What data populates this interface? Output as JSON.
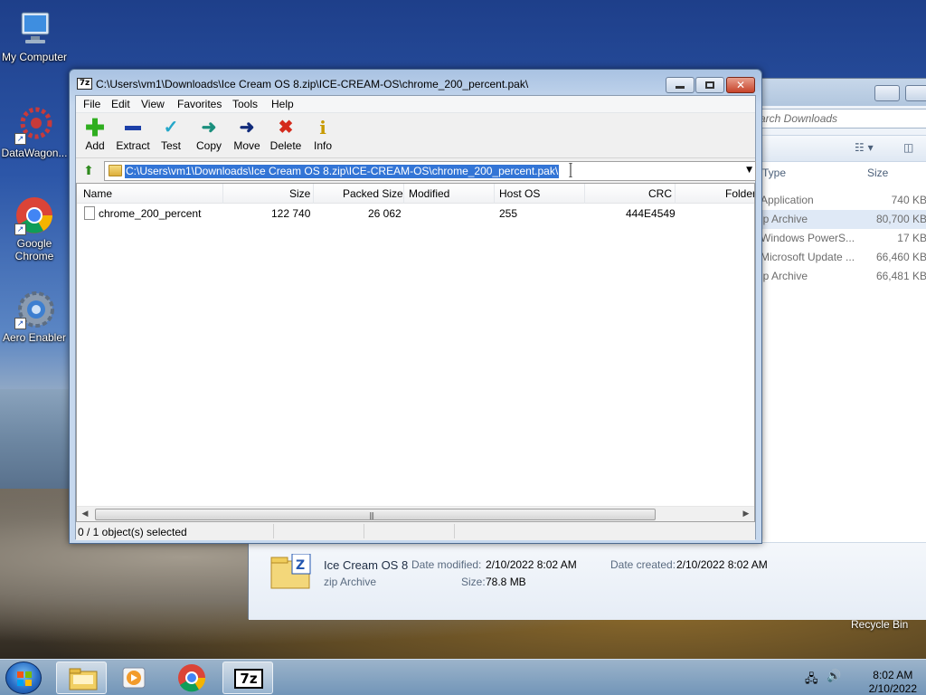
{
  "desktop": {
    "icons": [
      {
        "label": "My Computer"
      },
      {
        "label": "DataWagon..."
      },
      {
        "label": "Google Chrome"
      },
      {
        "label": "Aero Enabler"
      }
    ],
    "recycle_bin": "Recycle Bin"
  },
  "explorer": {
    "search_placeholder": "arch Downloads",
    "columns": {
      "type": "Type",
      "size": "Size"
    },
    "rows": [
      {
        "type": "Application",
        "size": "740 KB"
      },
      {
        "type": "ip Archive",
        "size": "80,700 KB"
      },
      {
        "type": "Windows PowerS...",
        "size": "17 KB"
      },
      {
        "type": "Microsoft Update ...",
        "size": "66,460 KB"
      },
      {
        "type": "ip Archive",
        "size": "66,481 KB"
      }
    ],
    "details": {
      "name": "Ice Cream OS 8",
      "kind": "zip Archive",
      "modified_label": "Date modified:",
      "modified_value": "2/10/2022 8:02 AM",
      "created_label": "Date created:",
      "created_value": "2/10/2022 8:02 AM",
      "size_label": "Size:",
      "size_value": "78.8 MB"
    }
  },
  "sevenzip": {
    "title": "C:\\Users\\vm1\\Downloads\\Ice Cream OS 8.zip\\ICE-CREAM-OS\\chrome_200_percent.pak\\",
    "app_icon": "7z",
    "menu": [
      "File",
      "Edit",
      "View",
      "Favorites",
      "Tools",
      "Help"
    ],
    "toolbar": [
      {
        "label": "Add",
        "icon": "add-icon"
      },
      {
        "label": "Extract",
        "icon": "extract-icon"
      },
      {
        "label": "Test",
        "icon": "test-icon"
      },
      {
        "label": "Copy",
        "icon": "copy-icon"
      },
      {
        "label": "Move",
        "icon": "move-icon"
      },
      {
        "label": "Delete",
        "icon": "delete-icon"
      },
      {
        "label": "Info",
        "icon": "info-icon"
      }
    ],
    "address": "C:\\Users\\vm1\\Downloads\\Ice Cream OS 8.zip\\ICE-CREAM-OS\\chrome_200_percent.pak\\",
    "columns": [
      "Name",
      "Size",
      "Packed Size",
      "Modified",
      "Host OS",
      "CRC",
      "Folder"
    ],
    "files": [
      {
        "name": "chrome_200_percent",
        "size": "122 740",
        "packed": "26 062",
        "modified": "",
        "host_os": "255",
        "crc": "444E4549"
      }
    ],
    "status": "0 / 1 object(s) selected"
  },
  "taskbar": {
    "app_7z": "7z",
    "time": "8:02 AM",
    "date": "2/10/2022"
  },
  "colors": {
    "selection": "#3375d6",
    "delete_red": "#d42a1c",
    "add_green": "#2fae1f"
  }
}
